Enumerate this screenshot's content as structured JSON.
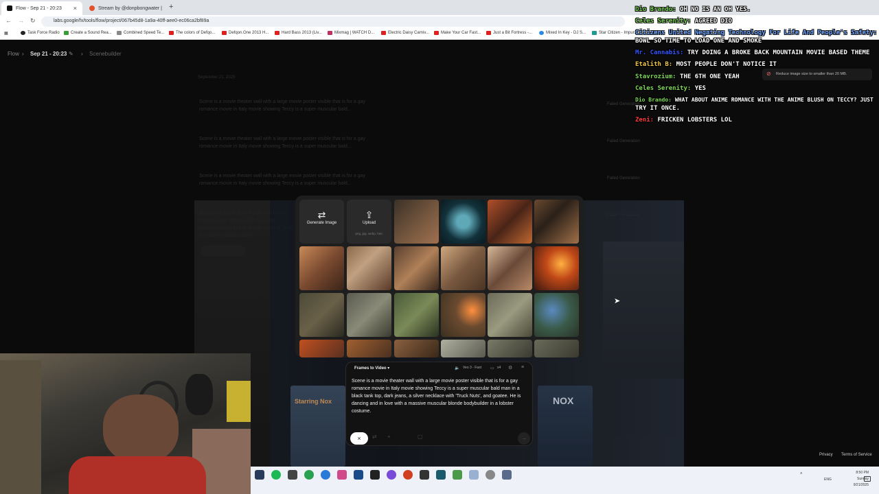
{
  "browser": {
    "tabs": [
      {
        "title": "Flow - Sep 21 - 20:23",
        "active": true
      },
      {
        "title": "Stream by @donpbongwater |",
        "active": false
      }
    ],
    "url": "labs.google/fx/tools/flow/project/067b45d8-1a9a-40ff-aee0-ec06ca2bf89a",
    "bookmarks": [
      "Task Force Radio",
      "Create a Sound Rea...",
      "Combined Speed Te...",
      "The colors of Defqo...",
      "Defqon.One 2013 H...",
      "Hard Bass 2013 (Liv...",
      "Mixmag | WATCH D...",
      "Electric Daisy Carniv...",
      "Make Your Car Fast...",
      "Just a Bit Fortress -...",
      "Mixed In Key - DJ S...",
      "Star Citizen - Impur..."
    ]
  },
  "app": {
    "breadcrumb": {
      "root": "Flow",
      "project": "Sep 21 - 20:23",
      "section": "Scenebuilder"
    },
    "date_header": "September 21, 2025",
    "faded_prompt": "Scene is a movie theater wall with a large movie poster visible that is for a gay romance movie in Italy movie showing Teccy is a super muscular bald...",
    "failed_label": "Failed Generation",
    "picker": {
      "generate_label": "Generate Image",
      "upload_label": "Upload",
      "upload_formats": "png, jpg, webp, heic"
    },
    "prompt_panel": {
      "mode": "Frames to Video",
      "model": "Veo 3 - Fast",
      "count": "x4",
      "text": "Scene is a movie theater wall with a large movie poster visible that is for a gay romance movie in Italy movie showing Teccy is a super muscular bald man in a black tank top, dark jeans, a silver necklace with 'Truck Nuts', and goatee. He is dancing and in love with a massive muscular blonde bodybuilder in a lobster costume."
    },
    "toast": "Reduce image size to smaller than 20 MB.",
    "footer": {
      "privacy": "Privacy",
      "terms": "Terms of Service"
    },
    "poster_titles": [
      "Starring Nox",
      "NOX"
    ]
  },
  "chat": [
    {
      "user": "Dio Brando:",
      "msg": "Oh no is an oh yes.",
      "color": "#7ed957"
    },
    {
      "user": "Celes Serenity:",
      "msg": "Agreed Dio",
      "color": "#7ed957"
    },
    {
      "user": "Citizens United Negating Technology For Life And People's Safety:",
      "msg": "",
      "color": "#6fa8ff"
    },
    {
      "user": "",
      "msg": "bowl so time to load one and smoke",
      "color": "#ffffff"
    },
    {
      "user": "Mr. Cannabis:",
      "msg": "try doing a broke back mountain movie based theme",
      "color": "#3355ff"
    },
    {
      "user": "Etalith B:",
      "msg": "most people don't notice it",
      "color": "#f3c846"
    },
    {
      "user": "Stavrozium:",
      "msg": "the 6th one yeah",
      "color": "#7ed957"
    },
    {
      "user": "Celes Serenity:",
      "msg": "yes",
      "color": "#7ed957"
    },
    {
      "user": "Dio Brando:",
      "msg": "What about anime romance with the anime blush on Teccy? Just",
      "color": "#7ed957"
    },
    {
      "user": "",
      "msg": "try it once.",
      "color": "#ffffff"
    },
    {
      "user": "Zeni:",
      "msg": "fricken lobsters lol",
      "color": "#ff3b3b"
    }
  ],
  "taskbar": {
    "lang": "ENG",
    "time": "8:50 PM",
    "day": "Sunday",
    "date": "9/21/2025"
  }
}
